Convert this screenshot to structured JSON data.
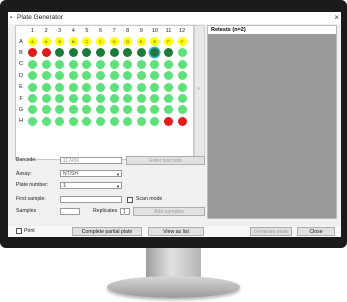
{
  "window": {
    "title": "Plate Generator",
    "close_glyph": "×"
  },
  "plate": {
    "columns": [
      "1",
      "2",
      "3",
      "4",
      "5",
      "6",
      "7",
      "8",
      "9",
      "10",
      "11",
      "12"
    ],
    "rows": [
      "A",
      "B",
      "C",
      "D",
      "E",
      "F",
      "G",
      "H"
    ],
    "row_a_labels": [
      "A",
      "A",
      "B",
      "B",
      "C",
      "C",
      "D",
      "D",
      "E",
      "E",
      "F",
      "F"
    ]
  },
  "sidebar": {
    "glyph": "»"
  },
  "retests": {
    "header": "Retests (n=2)"
  },
  "form": {
    "barcode_label": "Barcode:",
    "barcode_value": "112456",
    "enter_barcode_label": "Enter barcode",
    "assay_label": "Assay:",
    "assay_value": "NT/SH",
    "plate_number_label": "Plate number:",
    "plate_number_value": "1",
    "first_sample_label": "First sample:",
    "scan_mode_label": "Scan mode",
    "samples_label": "Samples",
    "replicates_label": "Replicates",
    "replicates_value": "1",
    "add_samples_label": "Add samples"
  },
  "footer": {
    "print_label": "Print",
    "complete_plate_label": "Complete partial plate",
    "view_list_label": "View as list",
    "generate_plate_label": "Generate plate",
    "close_label": "Close"
  },
  "colors": {
    "yellow": "#ffff00",
    "red": "#e21b1b",
    "dark_green": "#1f7a3a",
    "light_green": "#5ee07a",
    "selected_outline": "#38b4ee"
  }
}
